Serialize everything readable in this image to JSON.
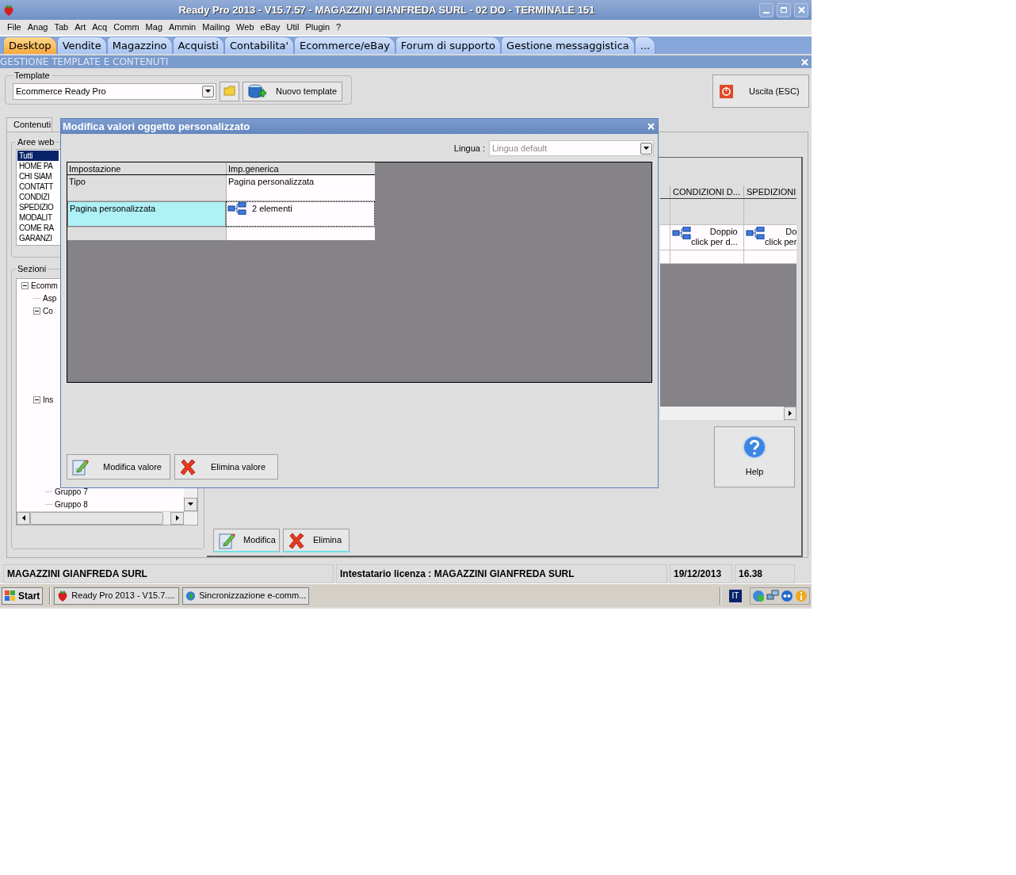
{
  "window": {
    "title": "Ready Pro 2013 - V15.7.57 - MAGAZZINI GIANFREDA SURL - 02 DO - TERMINALE 151"
  },
  "menu": [
    "File",
    "Anag",
    "Tab",
    "Art",
    "Acq",
    "Comm",
    "Mag",
    "Ammin",
    "Mailing",
    "Web",
    "eBay",
    "Util",
    "Plugin",
    "?"
  ],
  "tabs": [
    {
      "label": "Desktop",
      "selected": true
    },
    {
      "label": "Vendite",
      "selected": false
    },
    {
      "label": "Magazzino",
      "selected": false
    },
    {
      "label": "Acquisti",
      "selected": false
    },
    {
      "label": "Contabilita'",
      "selected": false
    },
    {
      "label": "Ecommerce/eBay",
      "selected": false
    },
    {
      "label": "Forum di supporto",
      "selected": false
    },
    {
      "label": "Gestione messaggistica",
      "selected": false
    },
    {
      "label": "...",
      "selected": false
    }
  ],
  "panel": {
    "title": "GESTIONE TEMPLATE E CONTENUTI"
  },
  "template": {
    "label": "Template",
    "value": "Ecommerce Ready Pro",
    "new_button": "Nuovo template"
  },
  "exit_button": "Uscita (ESC)",
  "content_tab": "Contenuti",
  "web_areas": {
    "label": "Aree web",
    "items": [
      {
        "label": "Tutti",
        "selected": true
      },
      {
        "label": "HOME PA",
        "selected": false
      },
      {
        "label": "CHI SIAM",
        "selected": false
      },
      {
        "label": "CONTATT",
        "selected": false
      },
      {
        "label": "CONDIZI",
        "selected": false
      },
      {
        "label": "SPEDIZIO",
        "selected": false
      },
      {
        "label": "MODALIT",
        "selected": false
      },
      {
        "label": "COME RA",
        "selected": false
      },
      {
        "label": "GARANZI",
        "selected": false
      }
    ]
  },
  "sections": {
    "label": "Sezioni",
    "tree": [
      {
        "label": "Ecomm",
        "expanded": true,
        "children": [
          {
            "label": "Asp"
          },
          {
            "label": "Co",
            "expanded": true
          },
          {
            "label": "Ins",
            "expanded": true,
            "children": [
              {
                "label": "Gruppo 7"
              },
              {
                "label": "Gruppo 8"
              }
            ]
          }
        ]
      }
    ]
  },
  "grid": {
    "columns": [
      "CONDIZIONI D...",
      "SPEDIZIONI"
    ],
    "rows": [
      {
        "cells": [
          {},
          {}
        ]
      },
      {
        "cells": [
          {
            "kind": "link",
            "lines": [
              "Doppio",
              "click per d..."
            ]
          },
          {
            "kind": "link",
            "lines": [
              "Do",
              "click per"
            ]
          }
        ]
      },
      {
        "cells": [
          {},
          {}
        ]
      }
    ]
  },
  "help_button": "Help",
  "actions": [
    {
      "kind": "edit",
      "label": "Modifica"
    },
    {
      "kind": "delete",
      "label": "Elimina"
    }
  ],
  "dialog": {
    "title": "Modifica valori oggetto personalizzato",
    "language_label": "Lingua :",
    "language": {
      "value": "Lingua default",
      "disabled": true
    },
    "columns": [
      "Impostazione",
      "Imp.generica"
    ],
    "rows": [
      {
        "setting": "Tipo",
        "value": "Pagina personalizzata",
        "selected": false
      },
      {
        "setting": "Pagina personalizzata",
        "value": "2 elementi",
        "kind": "link",
        "selected": true
      }
    ],
    "buttons": [
      {
        "kind": "edit",
        "label": "Modifica valore"
      },
      {
        "kind": "delete",
        "label": "Elimina valore"
      }
    ]
  },
  "status_bar": [
    "MAGAZZINI GIANFREDA SURL",
    "Intestatario licenza : MAGAZZINI GIANFREDA SURL",
    "19/12/2013",
    "16.38"
  ],
  "taskbar": {
    "start": "Start",
    "tasks": [
      {
        "kind": "app",
        "label": "Ready Pro 2013 - V15.7...."
      },
      {
        "kind": "globe",
        "label": "Sincronizzazione e-comm..."
      }
    ],
    "language": "IT"
  }
}
